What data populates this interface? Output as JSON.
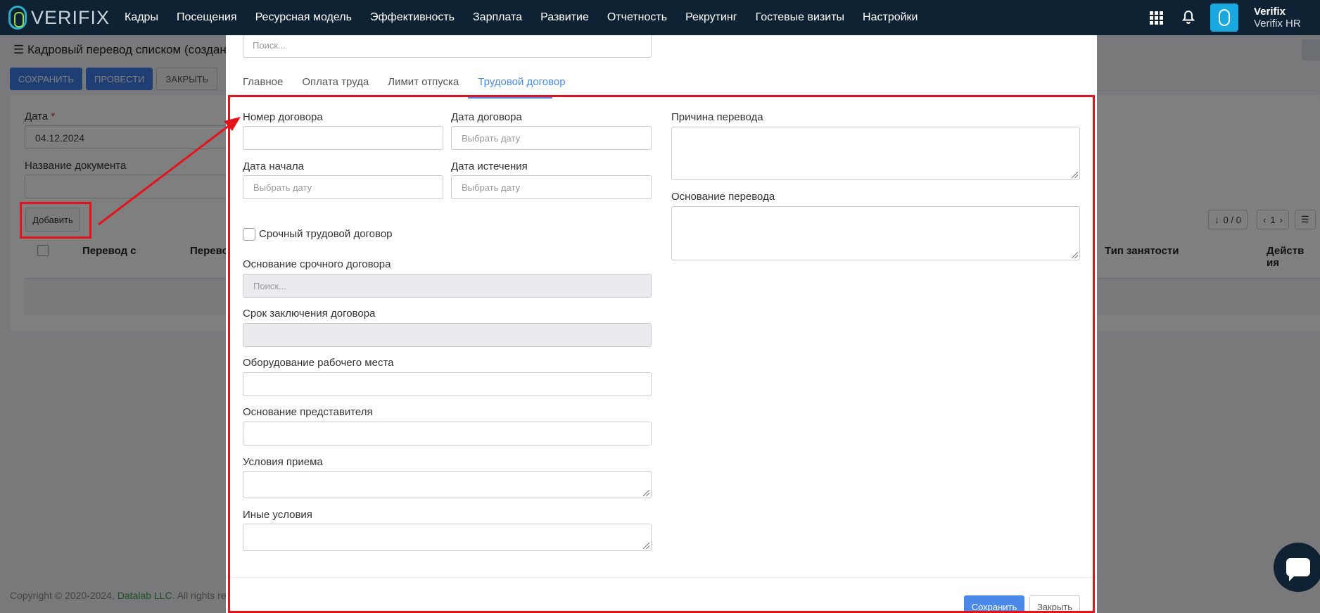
{
  "topbar": {
    "logo_text": "VERIFIX",
    "nav": [
      "Кадры",
      "Посещения",
      "Ресурсная модель",
      "Эффективность",
      "Зарплата",
      "Развитие",
      "Отчетность",
      "Рекрутинг",
      "Гостевые визиты",
      "Настройки"
    ],
    "user_name": "Verifix",
    "user_org": "Verifix HR"
  },
  "page": {
    "title": "Кадровый перевод списком (создан",
    "buttons": {
      "save": "СОХРАНИТЬ",
      "post": "ПРОВЕСТИ",
      "close": "ЗАКРЫТЬ"
    },
    "date_label": "Дата",
    "date_required": "*",
    "date_value": "04.12.2024",
    "docname_label": "Название документа",
    "add_button": "Добавить",
    "table_headers": [
      "Перевод с",
      "Перево",
      "Тип занятости",
      "Действ ия"
    ],
    "pager": {
      "count": "0 / 0",
      "page": "1"
    },
    "footer_text": "Copyright © 2020-2024,",
    "footer_link": "Datalab LLC.",
    "footer_rest": "All rights re"
  },
  "modal": {
    "search_placeholder": "Поиск...",
    "tabs": [
      "Главное",
      "Оплата труда",
      "Лимит отпуска",
      "Трудовой договор"
    ],
    "active_tab": "Трудовой договор",
    "fields": {
      "contract_number": "Номер договора",
      "contract_date": "Дата договора",
      "start_date": "Дата начала",
      "expiry_date": "Дата истечения",
      "date_placeholder": "Выбрать дату",
      "fixed_term": "Срочный трудовой договор",
      "fixed_term_basis": "Основание срочного договора",
      "fixed_term_basis_placeholder": "Поиск...",
      "contract_term": "Срок заключения договора",
      "workplace_equipment": "Оборудование рабочего места",
      "representative_basis": "Основание представителя",
      "hiring_conditions": "Условия приема",
      "other_conditions": "Иные условия",
      "transfer_reason": "Причина перевода",
      "transfer_basis": "Основание перевода"
    },
    "footer": {
      "save": "Сохранить",
      "close": "Закрыть"
    }
  },
  "annotation": {
    "color": "#e3131b"
  }
}
